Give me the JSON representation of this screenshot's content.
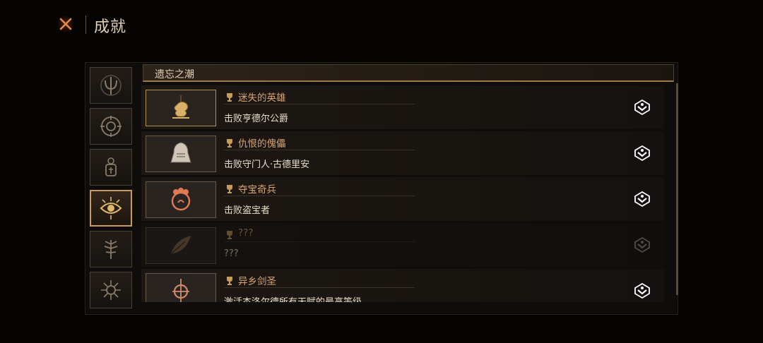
{
  "header": {
    "title": "成就"
  },
  "sidebar": {
    "tabs": [
      {
        "icon": "trident-emblem-icon",
        "active": false
      },
      {
        "icon": "sun-compass-emblem-icon",
        "active": false
      },
      {
        "icon": "lantern-emblem-icon",
        "active": false
      },
      {
        "icon": "eye-emblem-icon",
        "active": true
      },
      {
        "icon": "tree-emblem-icon",
        "active": false
      },
      {
        "icon": "thorn-emblem-icon",
        "active": false
      }
    ]
  },
  "category": {
    "title": "遗忘之潮"
  },
  "achievements": [
    {
      "title": "迷失的英雄",
      "description": "击败亨德尔公爵",
      "icon": "lion-heraldry-icon",
      "unlocked": true
    },
    {
      "title": "仇恨的傀儡",
      "description": "击败守门人·古德里安",
      "icon": "hooded-golem-icon",
      "unlocked": true
    },
    {
      "title": "夺宝奇兵",
      "description": "击败盗宝者",
      "icon": "treasure-thief-icon",
      "unlocked": true
    },
    {
      "title": "???",
      "description": "???",
      "icon": "hidden-leaf-icon",
      "unlocked": false
    },
    {
      "title": "异乡剑圣",
      "description": "激活杰洛尔德所有天赋的最高等级",
      "icon": "sword-saint-icon",
      "unlocked": true
    }
  ],
  "colors": {
    "accent": "#c79b5a",
    "title": "#d7a470",
    "text": "#e8ddc9",
    "panel": "#0f0d0b"
  }
}
